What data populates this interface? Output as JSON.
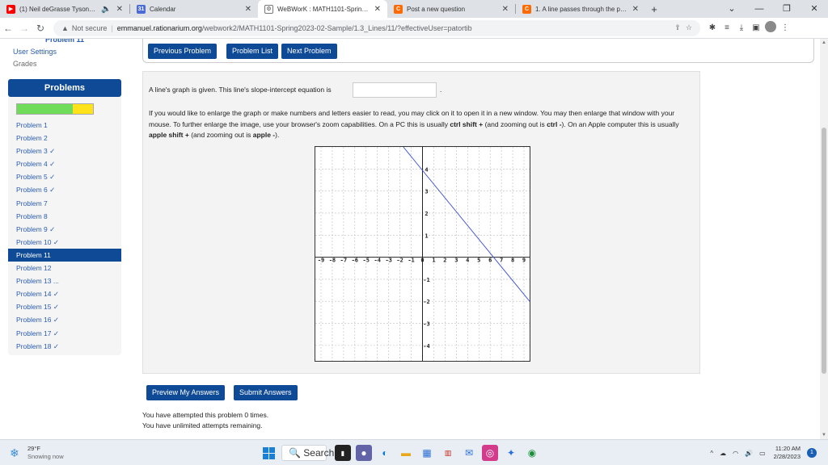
{
  "browser": {
    "tabs": [
      {
        "title": "(1) Neil deGrasse Tyson | Thi",
        "favicon_color": "#ff0000",
        "active": false,
        "muted_icon": "speaker-icon"
      },
      {
        "title": "Calendar",
        "favicon_color": "#4a6bd8",
        "active": false
      },
      {
        "title": "WeBWorK : MATH1101-Spring20",
        "favicon_color": "#444444",
        "active": true
      },
      {
        "title": "Post a new question",
        "favicon_color": "#ff6a00",
        "active": false
      },
      {
        "title": "1. A line passes through the poin",
        "favicon_color": "#ff6a00",
        "active": false
      }
    ],
    "new_tab": "+",
    "security_label": "Not secure",
    "url_host": "emmanuel.rationarium.org",
    "url_path": "/webwork2/MATH1101-Spring2023-02-Sample/1.3_Lines/11/?effectiveUser=patortib"
  },
  "sidebar": {
    "cut_label": "Problem 11",
    "user_settings": "User Settings",
    "grades": "Grades",
    "problems_heading": "Problems",
    "progress": {
      "correct_fraction": 0.73,
      "partial_fraction": 0.27,
      "green": "#6fdc5a",
      "yellow": "#ffe21a"
    },
    "problems": [
      {
        "label": "Problem 1",
        "current": false
      },
      {
        "label": "Problem 2",
        "current": false
      },
      {
        "label": "Problem 3 ✓",
        "current": false
      },
      {
        "label": "Problem 4 ✓",
        "current": false
      },
      {
        "label": "Problem 5 ✓",
        "current": false
      },
      {
        "label": "Problem 6 ✓",
        "current": false
      },
      {
        "label": "Problem 7",
        "current": false
      },
      {
        "label": "Problem 8",
        "current": false
      },
      {
        "label": "Problem 9 ✓",
        "current": false
      },
      {
        "label": "Problem 10 ✓",
        "current": false
      },
      {
        "label": "Problem 11",
        "current": true
      },
      {
        "label": "Problem 12",
        "current": false
      },
      {
        "label": "Problem 13 ...",
        "current": false
      },
      {
        "label": "Problem 14 ✓",
        "current": false
      },
      {
        "label": "Problem 15 ✓",
        "current": false
      },
      {
        "label": "Problem 16 ✓",
        "current": false
      },
      {
        "label": "Problem 17 ✓",
        "current": false
      },
      {
        "label": "Problem 18 ✓",
        "current": false
      }
    ]
  },
  "nav": {
    "previous": "Previous Problem",
    "list": "Problem List",
    "next": "Next Problem"
  },
  "problem": {
    "question": "A line's graph is given. This line's slope-intercept equation is",
    "answer_value": "",
    "question_end": ".",
    "instructions_1": "If you would like to enlarge the graph or make numbers and letters easier to read, you may click on it to open it in a new window. You may then enlarge that window with your mouse. To further enlarge the image, use your browser's zoom capabilities. On a PC this is usually ",
    "pc_zoom_in": "ctrl shift +",
    "instructions_2": " (and zooming out is ",
    "pc_zoom_out": "ctrl -",
    "instructions_3": "). On an Apple computer this is usually ",
    "mac_zoom_in": "apple shift +",
    "instructions_4": " (and zooming out is ",
    "mac_zoom_out": "apple -",
    "instructions_5": ")."
  },
  "chart_data": {
    "type": "line",
    "xlim": [
      -9.5,
      9.5
    ],
    "ylim": [
      -4.7,
      5.0
    ],
    "x_ticks": [
      -9,
      -8,
      -7,
      -6,
      -5,
      -4,
      -3,
      -2,
      -1,
      0,
      1,
      2,
      3,
      4,
      5,
      6,
      7,
      8,
      9
    ],
    "x_tick_labels": [
      "-9",
      "-8",
      "-7",
      "-6",
      "-5",
      "-4",
      "-3",
      "-2",
      "-1",
      "0",
      "1",
      "2",
      "3",
      "4",
      "5",
      "6",
      "7",
      "8",
      "9"
    ],
    "y_ticks": [
      4,
      3,
      2,
      1,
      -1,
      -2,
      -3,
      -4
    ],
    "y_tick_labels": [
      "4",
      "3",
      "2",
      "1",
      "-1",
      "-2",
      "-3",
      "-4"
    ],
    "grid": true,
    "series": [
      {
        "x": [
          -1.7,
          9.5
        ],
        "y": [
          5.0,
          -2.0
        ],
        "color": "#3b4fd6"
      }
    ]
  },
  "actions": {
    "preview": "Preview My Answers",
    "submit": "Submit Answers"
  },
  "attempts": {
    "line1": "You have attempted this problem 0 times.",
    "line2": "You have unlimited attempts remaining."
  },
  "taskbar": {
    "temperature": "29°F",
    "weather": "Snowing now",
    "search": "Search",
    "time": "11:20 AM",
    "date": "2/28/2023"
  }
}
